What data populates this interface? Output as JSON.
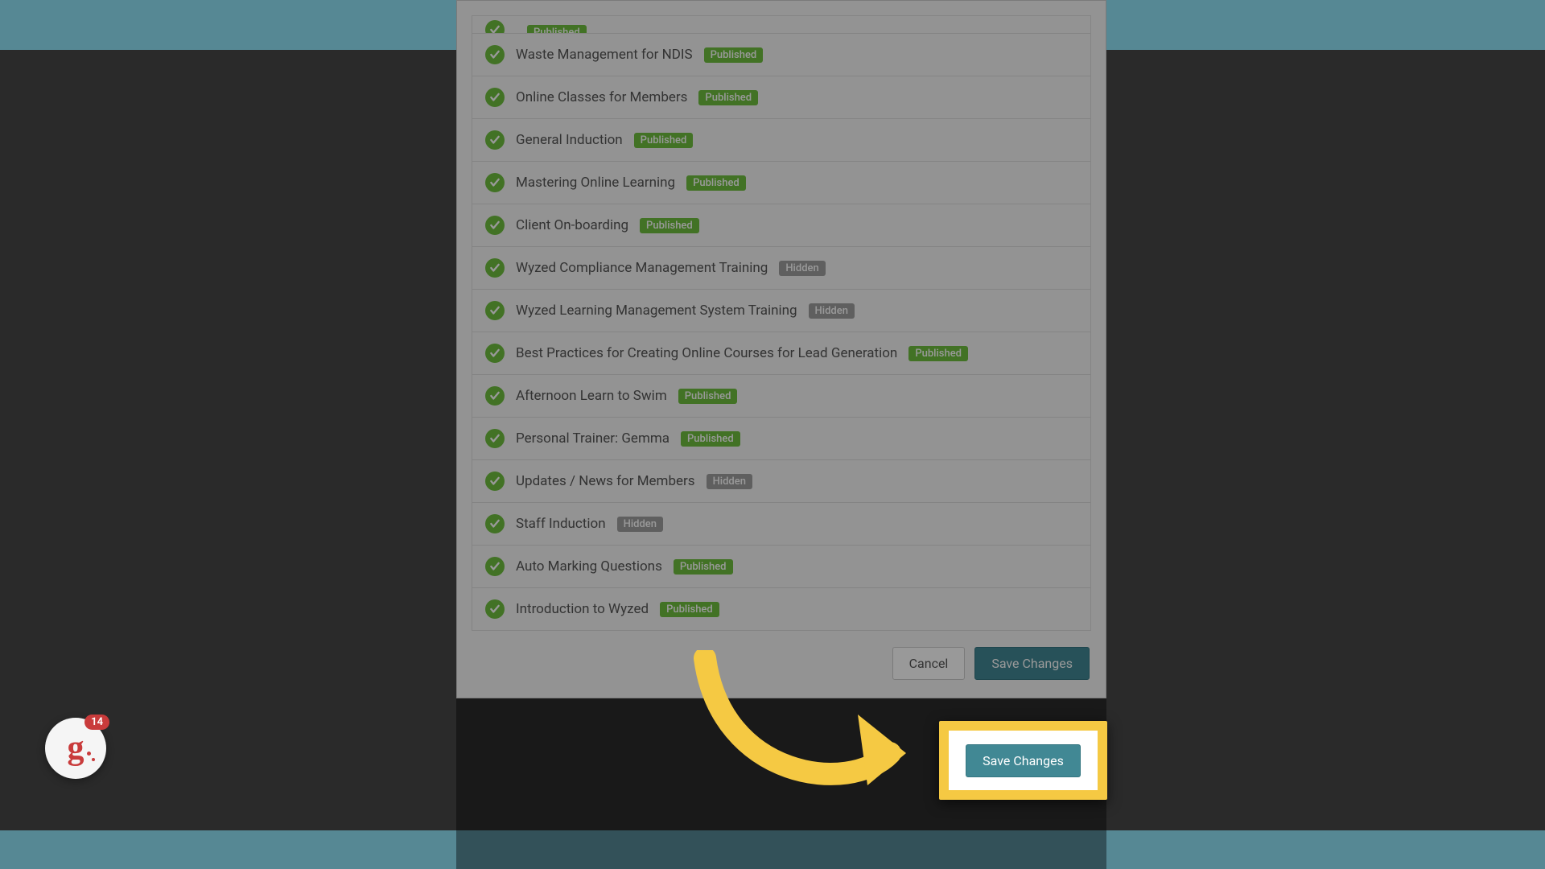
{
  "courses": [
    {
      "title": "",
      "status": "Published",
      "statusType": "published",
      "cut": true
    },
    {
      "title": "Waste Management for NDIS",
      "status": "Published",
      "statusType": "published"
    },
    {
      "title": "Online Classes for Members",
      "status": "Published",
      "statusType": "published"
    },
    {
      "title": "General Induction",
      "status": "Published",
      "statusType": "published"
    },
    {
      "title": "Mastering Online Learning",
      "status": "Published",
      "statusType": "published"
    },
    {
      "title": "Client On-boarding",
      "status": "Published",
      "statusType": "published"
    },
    {
      "title": "Wyzed Compliance Management Training",
      "status": "Hidden",
      "statusType": "hidden"
    },
    {
      "title": "Wyzed Learning Management System Training",
      "status": "Hidden",
      "statusType": "hidden"
    },
    {
      "title": "Best Practices for Creating Online Courses for Lead Generation",
      "status": "Published",
      "statusType": "published"
    },
    {
      "title": "Afternoon Learn to Swim",
      "status": "Published",
      "statusType": "published"
    },
    {
      "title": "Personal Trainer: Gemma",
      "status": "Published",
      "statusType": "published"
    },
    {
      "title": "Updates / News for Members",
      "status": "Hidden",
      "statusType": "hidden"
    },
    {
      "title": "Staff Induction",
      "status": "Hidden",
      "statusType": "hidden"
    },
    {
      "title": "Auto Marking Questions",
      "status": "Published",
      "statusType": "published"
    },
    {
      "title": "Introduction to Wyzed",
      "status": "Published",
      "statusType": "published"
    }
  ],
  "footer": {
    "cancel_label": "Cancel",
    "save_label": "Save Changes"
  },
  "widget": {
    "notification_count": "14",
    "glyph": "g"
  },
  "colors": {
    "accent_teal": "#418894",
    "success_green": "#6ebf3f",
    "highlight_yellow": "#f5c943",
    "badge_grey": "#9e9e9e"
  }
}
